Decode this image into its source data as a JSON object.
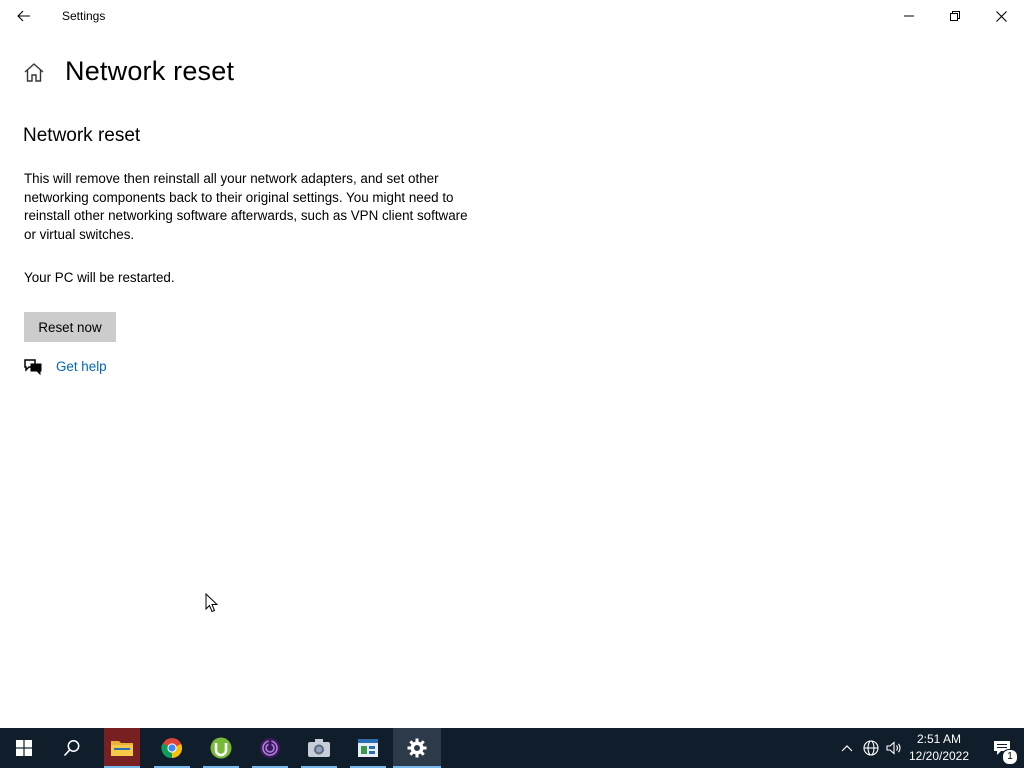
{
  "window": {
    "title": "Settings",
    "back_icon": "back-arrow-icon",
    "minimize_icon": "minimize-icon",
    "maximize_icon": "restore-icon",
    "close_icon": "close-icon"
  },
  "page": {
    "home_icon": "home-icon",
    "title": "Network reset",
    "section_title": "Network reset",
    "description": "This will remove then reinstall all your network adapters, and set other networking components back to their original settings. You might need to reinstall other networking software afterwards, such as VPN client software or virtual switches.",
    "restart_note": "Your PC will be restarted.",
    "reset_button_label": "Reset now",
    "help_link_label": "Get help",
    "help_icon": "get-help-icon"
  },
  "taskbar": {
    "items": [
      {
        "name": "start-button",
        "icon": "windows-logo-icon"
      },
      {
        "name": "search-button",
        "icon": "search-icon"
      },
      {
        "name": "file-explorer",
        "icon": "folder-icon"
      },
      {
        "name": "chrome",
        "icon": "chrome-icon"
      },
      {
        "name": "utorrent",
        "icon": "utorrent-icon"
      },
      {
        "name": "tor-browser",
        "icon": "tor-icon"
      },
      {
        "name": "camera",
        "icon": "camera-icon"
      },
      {
        "name": "remote-app",
        "icon": "app-icon"
      },
      {
        "name": "settings",
        "icon": "gear-icon"
      }
    ],
    "tray": {
      "show_hidden_icon": "chevron-up-icon",
      "network_icon": "globe-network-icon",
      "volume_icon": "speaker-icon",
      "time": "2:51 AM",
      "date": "12/20/2022",
      "notification_icon": "action-center-icon",
      "notification_count": "1"
    }
  },
  "colors": {
    "accent_link": "#0067b8",
    "button_bg": "#cccccc",
    "taskbar_bg": "#101d2b",
    "active_indicator": "#76b9ed"
  }
}
